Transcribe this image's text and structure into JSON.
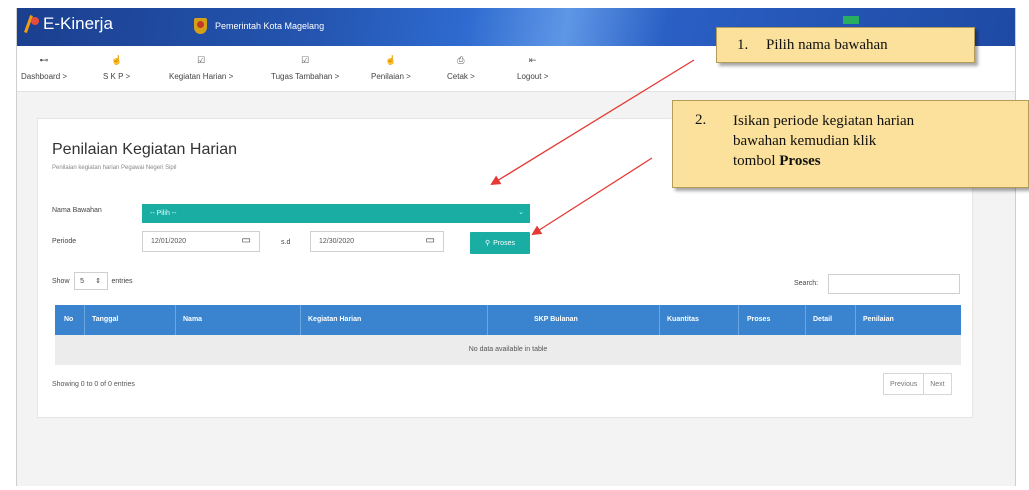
{
  "header": {
    "app_name": "E-Kinerja",
    "org_name": "Pemerintah Kota Magelang"
  },
  "menu": [
    {
      "icon": "dashboard-icon",
      "glyph": "⊷",
      "label": "Dashboard  >"
    },
    {
      "icon": "skp-icon",
      "glyph": "☝",
      "label": "S K P  >"
    },
    {
      "icon": "kegiatan-icon",
      "glyph": "☑",
      "label": "Kegiatan Harian  >"
    },
    {
      "icon": "tugas-icon",
      "glyph": "☑",
      "label": "Tugas Tambahan  >"
    },
    {
      "icon": "penilaian-icon",
      "glyph": "☝",
      "label": "Penilaian  >"
    },
    {
      "icon": "cetak-icon",
      "glyph": "⎙",
      "label": "Cetak  >"
    },
    {
      "icon": "logout-icon",
      "glyph": "⇤",
      "label": "Logout  >"
    }
  ],
  "page": {
    "title": "Penilaian Kegiatan Harian",
    "subtitle": "Penilaian kegiatan harian Pegawai Negeri Sipil"
  },
  "form": {
    "nama_bawahan_label": "Nama Bawahan",
    "nama_bawahan_value": "-- Pilih --",
    "periode_label": "Periode",
    "date_from": "12/01/2020",
    "date_to": "12/30/2020",
    "sd_label": "s.d",
    "proses_label": "Proses"
  },
  "table": {
    "show_label": "Show",
    "show_value": "5",
    "entries_label": "entries",
    "search_label": "Search:",
    "columns": [
      "No",
      "Tanggal",
      "Nama",
      "Kegiatan Harian",
      "SKP Bulanan",
      "Kuantitas",
      "Proses",
      "Detail",
      "Penilaian"
    ],
    "empty_message": "No data available in table",
    "info": "Showing 0 to 0 of 0 entries",
    "prev_label": "Previous",
    "next_label": "Next"
  },
  "callouts": {
    "c1_num": "1.",
    "c1_text": "Pilih nama bawahan",
    "c2_num": "2.",
    "c2_line1": "Isikan periode kegiatan harian",
    "c2_line2": "bawahan kemudian klik",
    "c2_line3_prefix": "tombol ",
    "c2_line3_bold": "Proses"
  },
  "colors": {
    "topbar": "#2455b0",
    "teal": "#1aada4",
    "table_header": "#3a84cf",
    "callout_bg": "#fbe19b",
    "arrow": "#e53935"
  }
}
